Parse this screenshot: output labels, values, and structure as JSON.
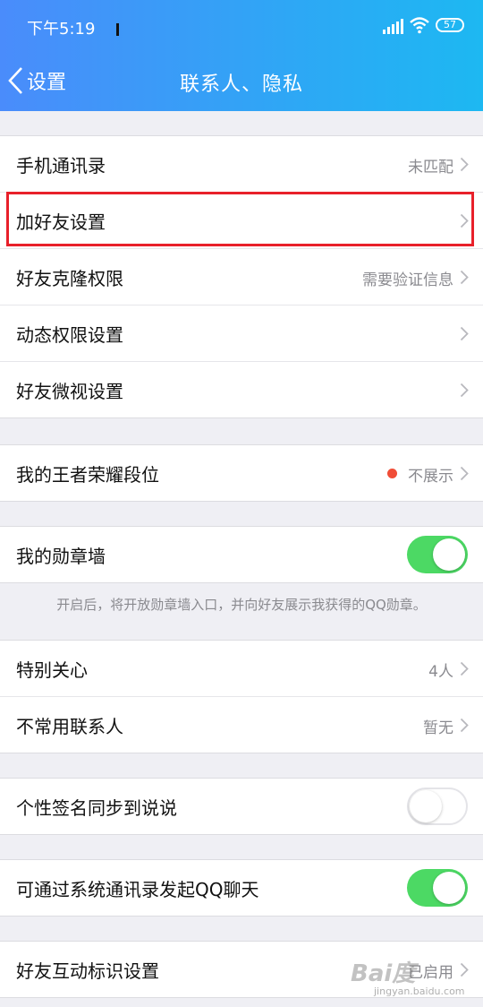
{
  "status_bar": {
    "time": "下午5:19",
    "battery": "57"
  },
  "nav": {
    "back_label": "设置",
    "title": "联系人、隐私"
  },
  "groups": {
    "g1": [
      {
        "label": "手机通讯录",
        "value": "未匹配"
      },
      {
        "label": "加好友设置",
        "value": ""
      },
      {
        "label": "好友克隆权限",
        "value": "需要验证信息"
      },
      {
        "label": "动态权限设置",
        "value": ""
      },
      {
        "label": "好友微视设置",
        "value": ""
      }
    ],
    "g2": [
      {
        "label": "我的王者荣耀段位",
        "value": "不展示",
        "dot_color": "#f04d37"
      }
    ],
    "g3": [
      {
        "label": "我的勋章墙",
        "toggle": true
      }
    ],
    "g3_hint": "开启后，将开放勋章墙入口，并向好友展示我获得的QQ勋章。",
    "g4": [
      {
        "label": "特别关心",
        "value": "4人"
      },
      {
        "label": "不常用联系人",
        "value": "暂无"
      }
    ],
    "g5": [
      {
        "label": "个性签名同步到说说",
        "toggle": false
      }
    ],
    "g6": [
      {
        "label": "可通过系统通讯录发起QQ聊天",
        "toggle": true
      }
    ],
    "g7": [
      {
        "label": "好友互动标识设置",
        "value": "已启用"
      }
    ]
  },
  "watermark": {
    "text": "Bai度",
    "sub": "jingyan.baidu.com"
  },
  "colors": {
    "header_start": "#4a8cfb",
    "header_end": "#1db8f2",
    "toggle_on": "#4cd964",
    "highlight": "#e8202a"
  }
}
